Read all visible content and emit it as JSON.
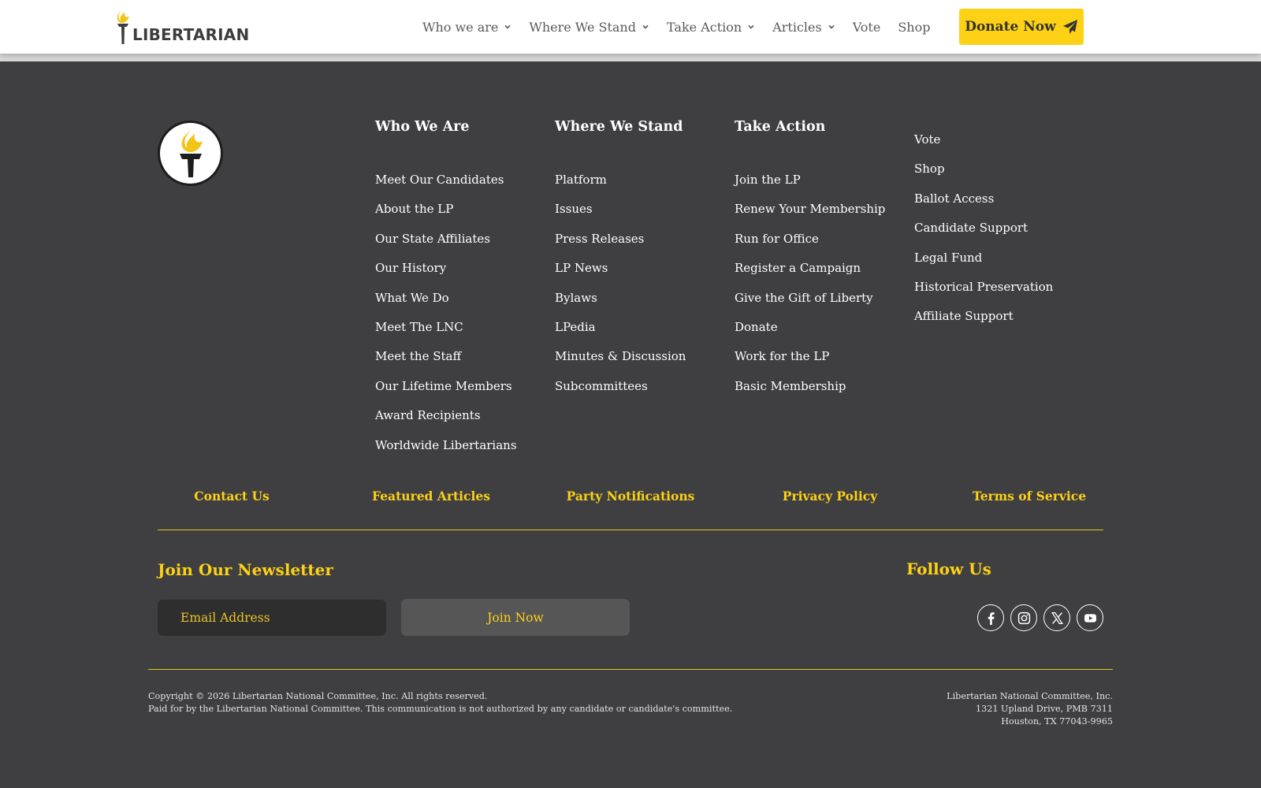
{
  "header": {
    "brand": "LIBERTARIAN",
    "nav": [
      {
        "label": "Who we are",
        "has_dropdown": true
      },
      {
        "label": "Where We Stand",
        "has_dropdown": true
      },
      {
        "label": "Take Action",
        "has_dropdown": true
      },
      {
        "label": "Articles",
        "has_dropdown": true
      },
      {
        "label": "Vote",
        "has_dropdown": false
      },
      {
        "label": "Shop",
        "has_dropdown": false
      }
    ],
    "donate_label": "Donate Now",
    "donate_icon": "paper-plane-icon"
  },
  "footer": {
    "columns": [
      {
        "title": "Who We Are",
        "links": [
          "Meet Our Candidates",
          "About the LP",
          "Our State Affiliates",
          "Our History",
          "What We Do",
          "Meet The LNC",
          "Meet the Staff",
          "Our Lifetime Members",
          "Award Recipients",
          "Worldwide Libertarians"
        ]
      },
      {
        "title": "Where We Stand",
        "links": [
          "Platform",
          "Issues",
          "Press Releases",
          "LP News",
          "Bylaws",
          "LPedia",
          "Minutes & Discussion",
          "Subcommittees"
        ]
      },
      {
        "title": "Take Action",
        "links": [
          "Join the LP",
          "Renew Your Membership",
          "Run for Office",
          "Register a Campaign",
          "Give the Gift of Liberty",
          "Donate",
          "Work for the LP",
          "Basic Membership"
        ]
      },
      {
        "title": "",
        "links": [
          "Vote",
          "Shop",
          "Ballot Access",
          "Candidate Support",
          "Legal Fund",
          "Historical Preservation",
          "Affiliate Support"
        ]
      }
    ],
    "bottom_links": [
      "Contact Us",
      "Featured Articles",
      "Party Notifications",
      "Privacy Policy",
      "Terms of Service"
    ],
    "newsletter": {
      "title": "Join Our Newsletter",
      "email_placeholder": "Email Address",
      "email_value": "",
      "submit_label": "Join Now"
    },
    "follow": {
      "title": "Follow Us",
      "icons": [
        "facebook-icon",
        "instagram-icon",
        "x-twitter-icon",
        "youtube-icon"
      ]
    },
    "legal": {
      "copyright": "Copyright © 2026 Libertarian National Committee, Inc. All rights reserved.",
      "disclaimer": "Paid for by the Libertarian National Committee. This communication is not authorized by any candidate or candidate's committee.",
      "org_name": "Libertarian National Committee, Inc.",
      "address_line1": "1321 Upland Drive, PMB 7311",
      "address_line2": "Houston, TX 77043-9965"
    }
  },
  "colors": {
    "accent": "#fcd116",
    "footer_bg": "#3f3f41",
    "header_bg": "#ffffff",
    "nav_text": "#5a5a5a"
  }
}
